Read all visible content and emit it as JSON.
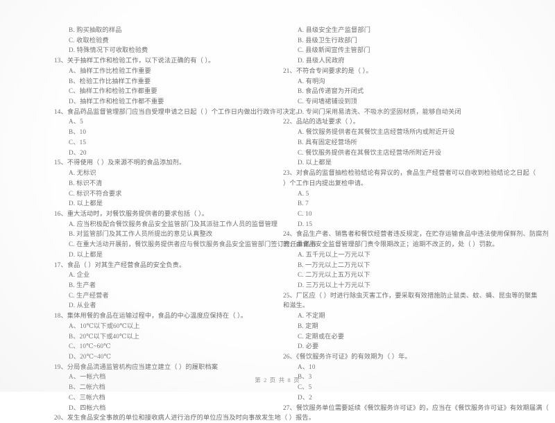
{
  "document": {
    "type": "exam-paper-scan",
    "language": "zh-CN",
    "footer": "第 2 页 共 8 页",
    "page_current": "2",
    "page_total": "8"
  },
  "left_column": [
    {
      "kind": "option",
      "text": "B. 购买抽取的样品"
    },
    {
      "kind": "option",
      "text": "C. 收取检验费"
    },
    {
      "kind": "option",
      "text": "D. 特殊情况下可收取检验费"
    },
    {
      "kind": "question",
      "text": "13、关于抽样工作和检验工作，以下说法正确的有（      ）。"
    },
    {
      "kind": "option",
      "text": "A、抽样工作比检验工作重要"
    },
    {
      "kind": "option",
      "text": "B、检验工作比抽样工作重要"
    },
    {
      "kind": "option",
      "text": "C、抽样工作和检验工作都重要"
    },
    {
      "kind": "option",
      "text": "D、抽样工作和检验工作都不重要"
    },
    {
      "kind": "question",
      "text": "14、食品药品监督管理部门应当自受理申请之日起（      ）个工作日内做出行政许可决定。"
    },
    {
      "kind": "option",
      "text": "A、5"
    },
    {
      "kind": "option",
      "text": "B、10"
    },
    {
      "kind": "option",
      "text": "C、15"
    },
    {
      "kind": "option",
      "text": "D、20"
    },
    {
      "kind": "question",
      "text": "15、不得使用（     ）及来源不明的食品添加剂。"
    },
    {
      "kind": "option",
      "text": "A. 无标识"
    },
    {
      "kind": "option",
      "text": "B. 标识不清"
    },
    {
      "kind": "option",
      "text": "C. 标识不符合要求"
    },
    {
      "kind": "option",
      "text": "D. 以上都是"
    },
    {
      "kind": "question",
      "text": "16、重大活动时，对餐饮服务提供者的要求包括（      ）。"
    },
    {
      "kind": "option",
      "text": "A. 应当积极配合餐饮服务食品安全监管部门及其派驻工作人员的监督管理"
    },
    {
      "kind": "option",
      "text": "B. 对监管部门及其工作人员所提出的意见认真整改"
    },
    {
      "kind": "option",
      "text": "C. 在重大活动开展前，餐饮服务提供者应与餐饮服务食品安全监管部门签订责任承诺书"
    },
    {
      "kind": "option",
      "text": "D. 以上都是"
    },
    {
      "kind": "question",
      "text": "17、食品（      ）对其生产经营食品的安全负责。"
    },
    {
      "kind": "option",
      "text": "A. 企业"
    },
    {
      "kind": "option",
      "text": "B. 生产者"
    },
    {
      "kind": "option",
      "text": "C. 生产经营者"
    },
    {
      "kind": "option",
      "text": "D. 从业者"
    },
    {
      "kind": "question",
      "text": "18、集体用餐的食品在运输过程中，食品的中心温度应保持在（      ）。"
    },
    {
      "kind": "option",
      "text": "A、10℃以下或60℃以上"
    },
    {
      "kind": "option",
      "text": "B、20℃以下或40℃以上"
    },
    {
      "kind": "option",
      "text": "C、10℃~60℃"
    },
    {
      "kind": "option",
      "text": "D、20℃~40℃"
    },
    {
      "kind": "question",
      "text": "19、分局食品流通监管机构应当建立建立（      ）的履职档案"
    },
    {
      "kind": "option",
      "text": "A、一帐六档"
    },
    {
      "kind": "option",
      "text": "B、二帐六档"
    },
    {
      "kind": "option",
      "text": "C、三帐六档"
    },
    {
      "kind": "option",
      "text": "D、四帐六档"
    },
    {
      "kind": "question",
      "text": "20、发生食品安全事故的单位和接收病人进行治疗的单位应当及时向事故发生地（      ）报告。"
    }
  ],
  "right_column": [
    {
      "kind": "option",
      "text": "A. 县级安全生产监督部门"
    },
    {
      "kind": "option",
      "text": "B. 县级卫生行政部门"
    },
    {
      "kind": "option",
      "text": "C. 县级新闻宣传主管部门"
    },
    {
      "kind": "option",
      "text": "D. 县级人民政府"
    },
    {
      "kind": "question",
      "text": "21、不符合专间要求的是（      ）。"
    },
    {
      "kind": "option",
      "text": "A. 有明沟"
    },
    {
      "kind": "option",
      "text": "B. 食品传递窗为开闭式"
    },
    {
      "kind": "option",
      "text": "C. 专间墙裙铺设到顶"
    },
    {
      "kind": "option",
      "text": "D. 专间门采用易清洗、不吸水的坚固材质，能够自动关闭"
    },
    {
      "kind": "question",
      "text": "22、品站的选址要求（      ）。"
    },
    {
      "kind": "option",
      "text": "A. 餐饮服务提供者在其餐饮主店经营场所内或附近开设"
    },
    {
      "kind": "option",
      "text": "B. 具有固定经营场所"
    },
    {
      "kind": "option",
      "text": "C. 餐饮服务提供者在其餐饮主店经营场所附近开设"
    },
    {
      "kind": "option",
      "text": "D. 以上都是"
    },
    {
      "kind": "question",
      "text": "23、对食品的监督抽检检验结论有异议的，食品生产经营者可以自收到检验结论之日起（"
    },
    {
      "kind": "cont",
      "text": "）个工作日内提出复检申请。"
    },
    {
      "kind": "option",
      "text": "A. 5"
    },
    {
      "kind": "option",
      "text": "B. 7"
    },
    {
      "kind": "option",
      "text": "C. 10"
    },
    {
      "kind": "option",
      "text": "D. 15"
    },
    {
      "kind": "question",
      "text": "24、食品生产者、销售者和餐饮经营者违反规定，在贮存运输食品中违法使用保鲜剂、防腐剂"
    },
    {
      "kind": "cont",
      "text": "的，由食品安全监督管理部门责令限期改正；逾期不改正的，处（      ）罚款。"
    },
    {
      "kind": "option",
      "text": "A. 五千元以上一万元以下"
    },
    {
      "kind": "option",
      "text": "B. 一万元以上二万元以下"
    },
    {
      "kind": "option",
      "text": "C. 二万元以上五万元以下"
    },
    {
      "kind": "option",
      "text": "D. 三万元以上十万元以下"
    },
    {
      "kind": "question",
      "text": "25、厂区应（      ）时进行除虫灭害工作，要采取有效措施防止鼠类、蚊、蝇、昆虫等的聚集"
    },
    {
      "kind": "cont",
      "text": "和滋生。"
    },
    {
      "kind": "option",
      "text": "A. 不定期"
    },
    {
      "kind": "option",
      "text": "B. 定期"
    },
    {
      "kind": "option",
      "text": "C. 定期或在必要"
    },
    {
      "kind": "option",
      "text": "D. 必要"
    },
    {
      "kind": "question",
      "text": "26、《餐饮服务许可证》的有效期为（      ）年。"
    },
    {
      "kind": "option",
      "text": "A、10"
    },
    {
      "kind": "option",
      "text": "B、3"
    },
    {
      "kind": "option",
      "text": "C、5"
    },
    {
      "kind": "option",
      "text": "D、2"
    },
    {
      "kind": "question",
      "text": "27、餐饮服务单位需要延续《餐饮服务许可证》的，应当在《餐饮服务许可证》有效期届满（"
    }
  ]
}
